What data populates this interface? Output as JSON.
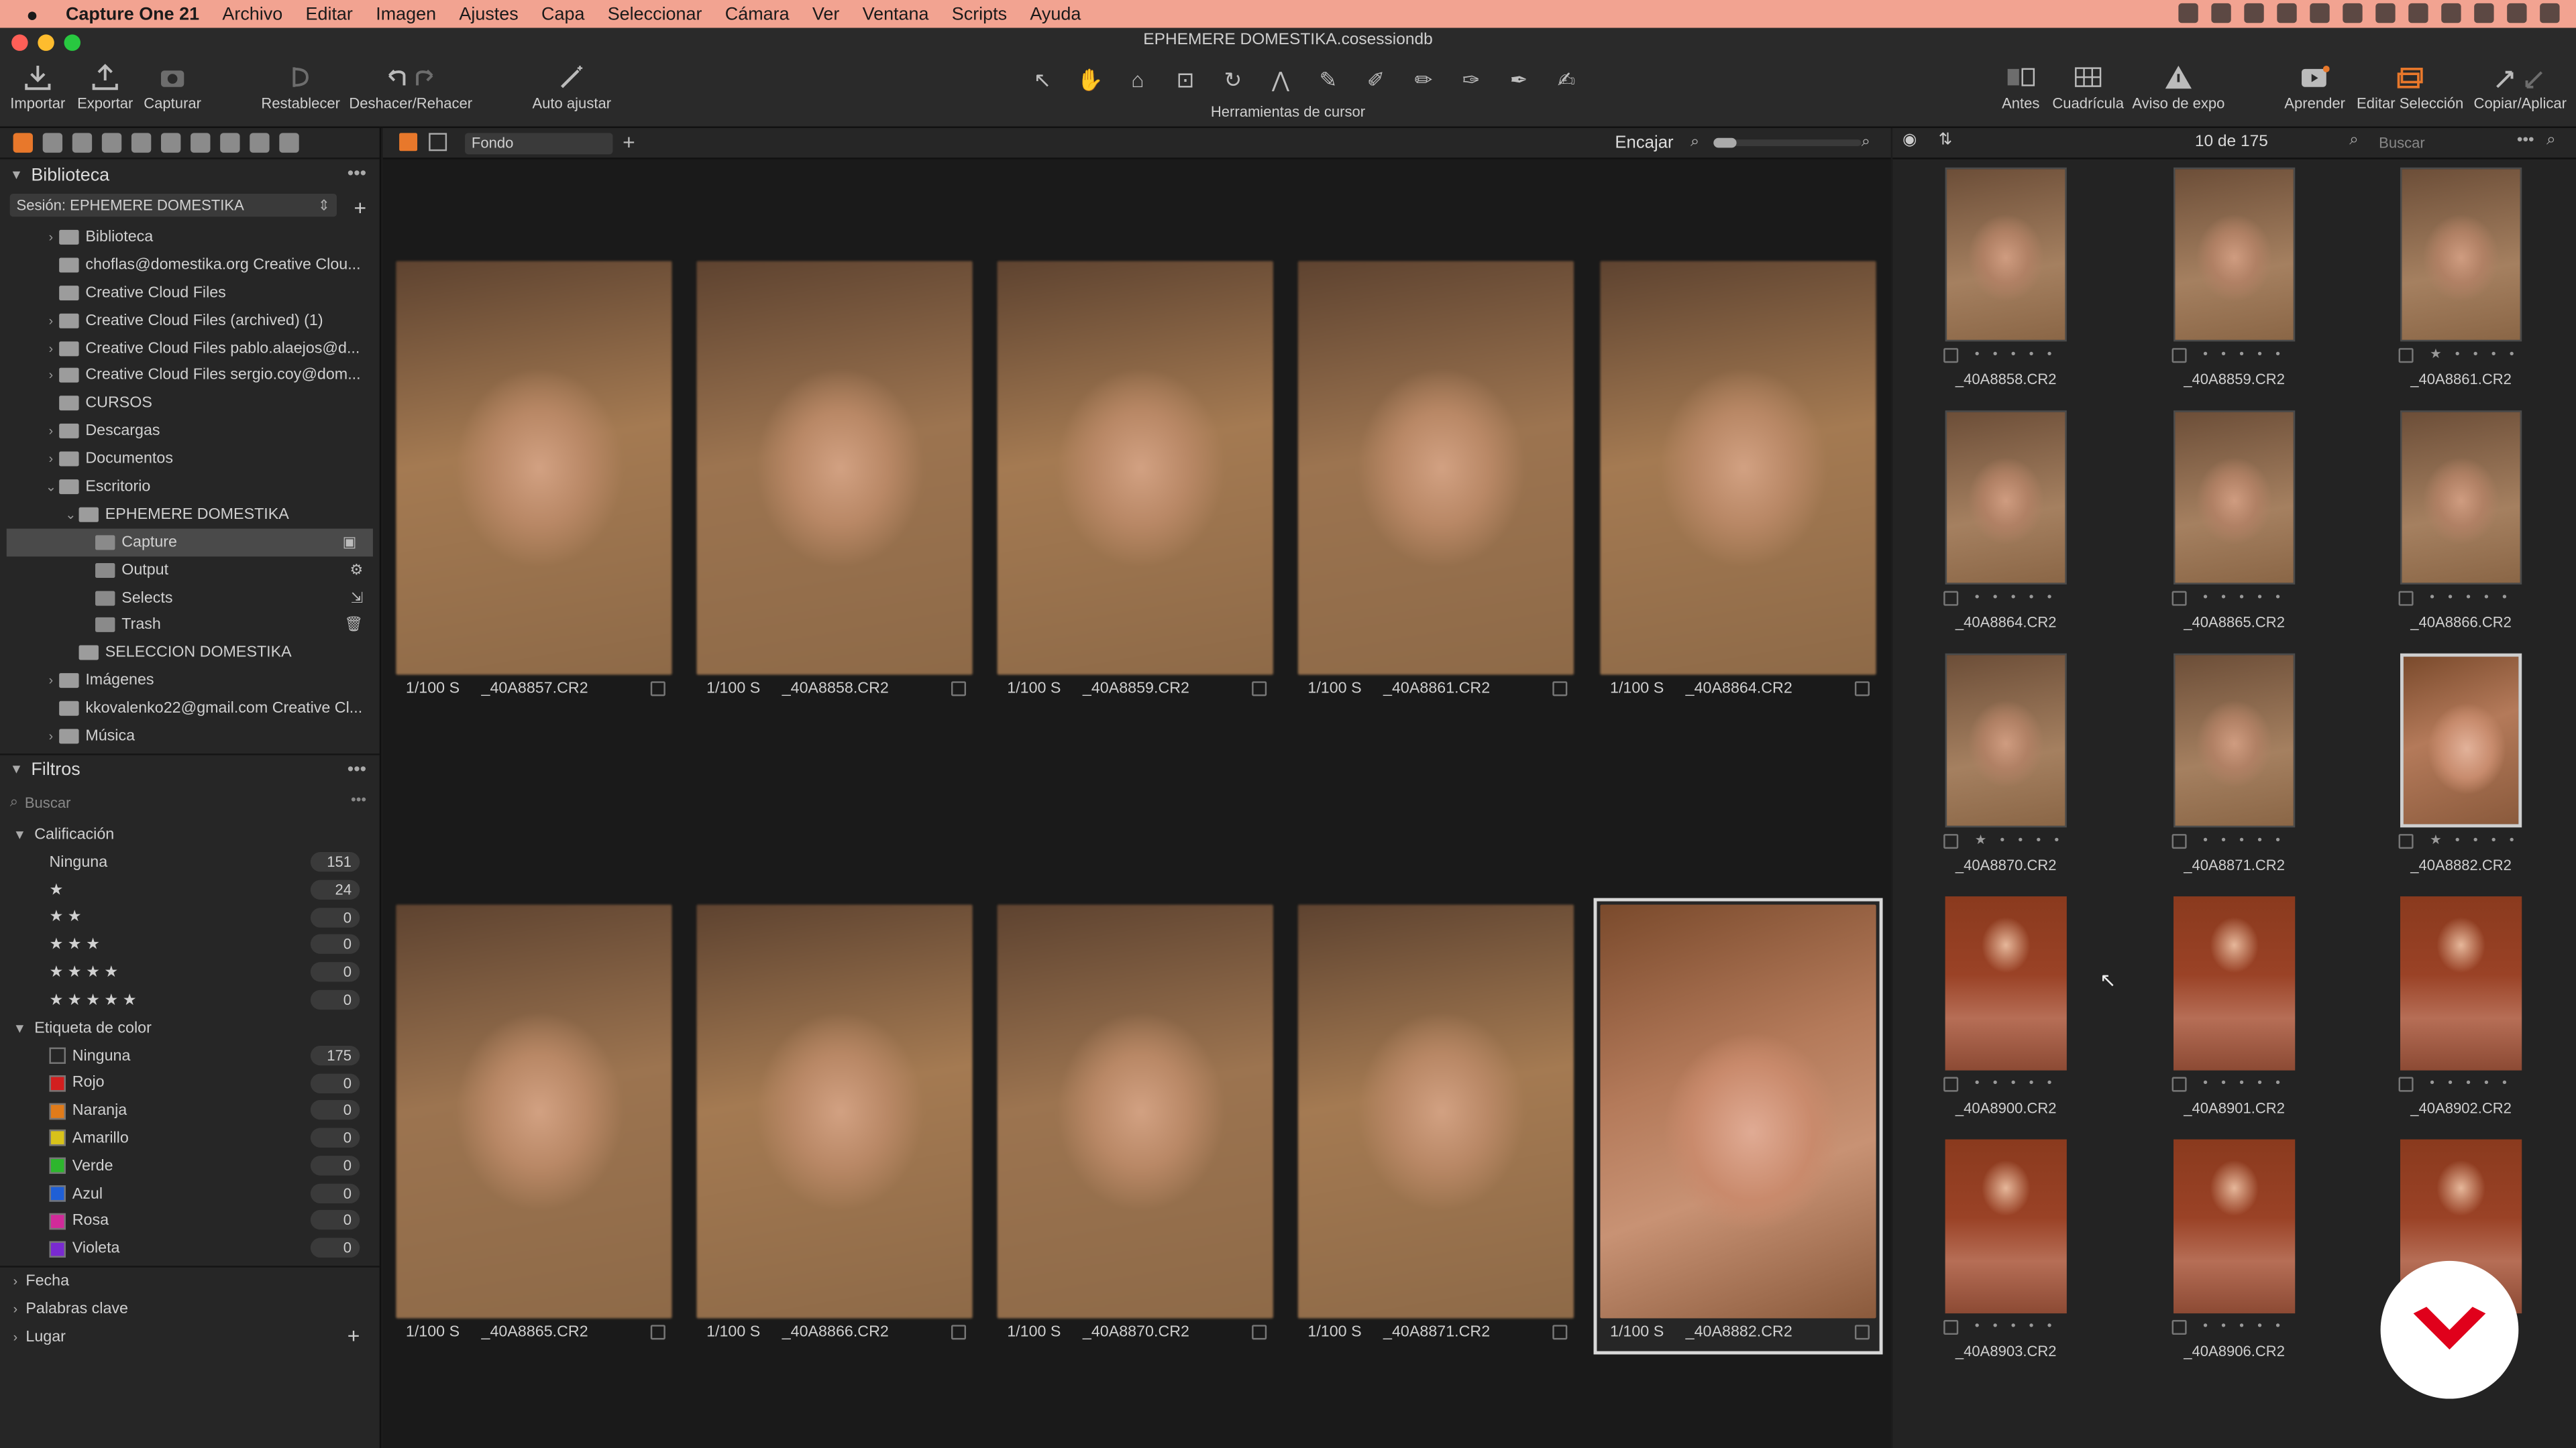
{
  "menubar": {
    "items": [
      "Capture One 21",
      "Archivo",
      "Editar",
      "Imagen",
      "Ajustes",
      "Capa",
      "Seleccionar",
      "Cámara",
      "Ver",
      "Ventana",
      "Scripts",
      "Ayuda"
    ]
  },
  "window": {
    "title": "EPHEMERE DOMESTIKA.cosessiondb"
  },
  "toolbar": {
    "left_buttons": [
      "Importar",
      "Exportar",
      "Capturar",
      "Restablecer",
      "Deshacer/Rehacer",
      "Auto ajustar"
    ],
    "cursor_tools_label": "Herramientas de cursor",
    "right_buttons": [
      "Antes",
      "Cuadrícula",
      "Aviso de expo",
      "Aprender",
      "Editar Selección",
      "Copiar/Aplicar"
    ]
  },
  "library": {
    "title": "Biblioteca",
    "session_label": "Sesión: EPHEMERE DOMESTIKA",
    "tree": [
      {
        "label": "Biblioteca",
        "level": 1,
        "arrow": "›"
      },
      {
        "label": "choflas@domestika.org Creative Clou...",
        "level": 1,
        "arrow": ""
      },
      {
        "label": "Creative Cloud Files",
        "level": 1,
        "arrow": ""
      },
      {
        "label": "Creative Cloud Files (archived) (1)",
        "level": 1,
        "arrow": "›"
      },
      {
        "label": "Creative Cloud Files pablo.alaejos@d...",
        "level": 1,
        "arrow": "›"
      },
      {
        "label": "Creative Cloud Files sergio.coy@dom...",
        "level": 1,
        "arrow": "›"
      },
      {
        "label": "CURSOS",
        "level": 1,
        "arrow": ""
      },
      {
        "label": "Descargas",
        "level": 1,
        "arrow": "›"
      },
      {
        "label": "Documentos",
        "level": 1,
        "arrow": "›"
      },
      {
        "label": "Escritorio",
        "level": 1,
        "arrow": "⌄"
      },
      {
        "label": "EPHEMERE DOMESTIKA",
        "level": 2,
        "arrow": "⌄"
      },
      {
        "label": "Capture",
        "level": 3,
        "arrow": "",
        "selected": true
      },
      {
        "label": "Output",
        "level": 3,
        "arrow": ""
      },
      {
        "label": "Selects",
        "level": 3,
        "arrow": ""
      },
      {
        "label": "Trash",
        "level": 3,
        "arrow": ""
      },
      {
        "label": "SELECCION DOMESTIKA",
        "level": 2,
        "arrow": ""
      },
      {
        "label": "Imágenes",
        "level": 1,
        "arrow": "›"
      },
      {
        "label": "kkovalenko22@gmail.com Creative Cl...",
        "level": 1,
        "arrow": ""
      },
      {
        "label": "Música",
        "level": 1,
        "arrow": "›"
      }
    ]
  },
  "filters": {
    "title": "Filtros",
    "search_placeholder": "Buscar",
    "rating_title": "Calificación",
    "ratings": [
      {
        "label": "Ninguna",
        "count": "151"
      },
      {
        "label": "★",
        "count": "24"
      },
      {
        "label": "★ ★",
        "count": "0"
      },
      {
        "label": "★ ★ ★",
        "count": "0"
      },
      {
        "label": "★ ★ ★ ★",
        "count": "0"
      },
      {
        "label": "★ ★ ★ ★ ★",
        "count": "0"
      }
    ],
    "color_title": "Etiqueta de color",
    "colors": [
      {
        "label": "Ninguna",
        "count": "175",
        "color": "#262626"
      },
      {
        "label": "Rojo",
        "count": "0",
        "color": "#d21f1f"
      },
      {
        "label": "Naranja",
        "count": "0",
        "color": "#e07b1a"
      },
      {
        "label": "Amarillo",
        "count": "0",
        "color": "#d8c21a"
      },
      {
        "label": "Verde",
        "count": "0",
        "color": "#2db62d"
      },
      {
        "label": "Azul",
        "count": "0",
        "color": "#1f5fd6"
      },
      {
        "label": "Rosa",
        "count": "0",
        "color": "#d12a9a"
      },
      {
        "label": "Violeta",
        "count": "0",
        "color": "#7a2ad1"
      }
    ],
    "extra": [
      "Fecha",
      "Palabras clave",
      "Lugar"
    ]
  },
  "viewer": {
    "dropdown": "Fondo",
    "fit_label": "Encajar",
    "thumbs": [
      {
        "shutter": "1/100 S",
        "name": "_40A8857.CR2"
      },
      {
        "shutter": "1/100 S",
        "name": "_40A8858.CR2"
      },
      {
        "shutter": "1/100 S",
        "name": "_40A8859.CR2"
      },
      {
        "shutter": "1/100 S",
        "name": "_40A8861.CR2"
      },
      {
        "shutter": "1/100 S",
        "name": "_40A8864.CR2"
      },
      {
        "shutter": "1/100 S",
        "name": "_40A8865.CR2"
      },
      {
        "shutter": "1/100 S",
        "name": "_40A8866.CR2"
      },
      {
        "shutter": "1/100 S",
        "name": "_40A8870.CR2"
      },
      {
        "shutter": "1/100 S",
        "name": "_40A8871.CR2"
      },
      {
        "shutter": "1/100 S",
        "name": "_40A8882.CR2"
      }
    ]
  },
  "browser": {
    "count_label": "10 de 175",
    "search_placeholder": "Buscar",
    "thumbs": [
      {
        "name": "_40A8858.CR2",
        "stars": "• • • • •",
        "tone": "blur"
      },
      {
        "name": "_40A8859.CR2",
        "stars": "• • • • •",
        "tone": "blur"
      },
      {
        "name": "_40A8861.CR2",
        "stars": "★ • • • •",
        "tone": "blur"
      },
      {
        "name": "_40A8864.CR2",
        "stars": "• • • • •",
        "tone": "blur"
      },
      {
        "name": "_40A8865.CR2",
        "stars": "• • • • •",
        "tone": "blur"
      },
      {
        "name": "_40A8866.CR2",
        "stars": "• • • • •",
        "tone": "blur"
      },
      {
        "name": "_40A8870.CR2",
        "stars": "★ • • • •",
        "tone": "blur"
      },
      {
        "name": "_40A8871.CR2",
        "stars": "• • • • •",
        "tone": "blur"
      },
      {
        "name": "_40A8882.CR2",
        "stars": "★ • • • •",
        "tone": "sharp"
      },
      {
        "name": "_40A8900.CR2",
        "stars": "• • • • •",
        "tone": "dress"
      },
      {
        "name": "_40A8901.CR2",
        "stars": "• • • • •",
        "tone": "dress"
      },
      {
        "name": "_40A8902.CR2",
        "stars": "• • • • •",
        "tone": "dress"
      },
      {
        "name": "_40A8903.CR2",
        "stars": "• • • • •",
        "tone": "dress"
      },
      {
        "name": "_40A8906.CR2",
        "stars": "• • • • •",
        "tone": "dress"
      },
      {
        "name": "",
        "stars": "",
        "tone": "dress"
      }
    ]
  },
  "colors": {
    "accent": "#e8782b",
    "menubar_bg": "#f2a391",
    "badge": "#e0001b"
  }
}
